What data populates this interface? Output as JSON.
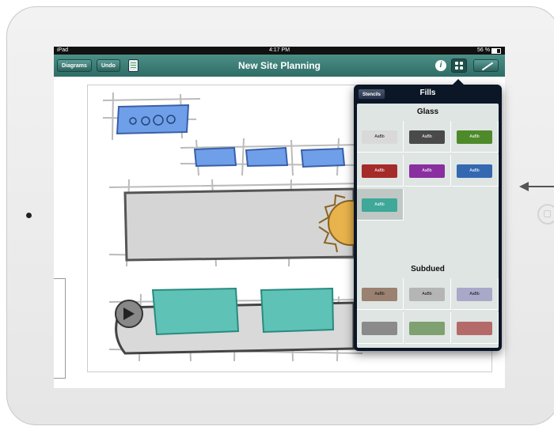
{
  "status": {
    "carrier": "iPad",
    "time": "4:17 PM",
    "battery": "56 %"
  },
  "nav": {
    "diagrams": "Diagrams",
    "undo": "Undo",
    "title": "New Site Planning"
  },
  "popover": {
    "stencils": "Stencils",
    "title": "Fills",
    "sections": [
      {
        "title": "Glass",
        "swatches": [
          {
            "label": "AaBb",
            "color": "#d9d9d9",
            "text": "#111"
          },
          {
            "label": "AaBb",
            "color": "#4a4a4a",
            "text": "#fff"
          },
          {
            "label": "AaBb",
            "color": "#4e8a2a",
            "text": "#fff"
          },
          {
            "label": "AaBb",
            "color": "#a52a2a",
            "text": "#fff"
          },
          {
            "label": "AaBb",
            "color": "#8a2fa0",
            "text": "#fff"
          },
          {
            "label": "AaBb",
            "color": "#3468b0",
            "text": "#fff"
          },
          {
            "label": "AaBb",
            "color": "#3fa899",
            "text": "#fff"
          }
        ]
      },
      {
        "title": "Subdued",
        "swatches": [
          {
            "label": "AaBb",
            "color": "#9a8170",
            "text": "#111"
          },
          {
            "label": "AaBb",
            "color": "#b5b5b5",
            "text": "#111"
          },
          {
            "label": "AaBb",
            "color": "#a8a8c8",
            "text": "#111"
          },
          {
            "label": "",
            "color": "#8a8a8a",
            "text": "#111"
          },
          {
            "label": "",
            "color": "#7fa070",
            "text": "#111"
          },
          {
            "label": "",
            "color": "#b56a6a",
            "text": "#111"
          }
        ]
      }
    ]
  },
  "colors": {
    "navbar": "#3a7a73",
    "blue_fill": "#6f9fe8",
    "teal_fill": "#5fc2b6",
    "sun": "#e8b24c"
  }
}
